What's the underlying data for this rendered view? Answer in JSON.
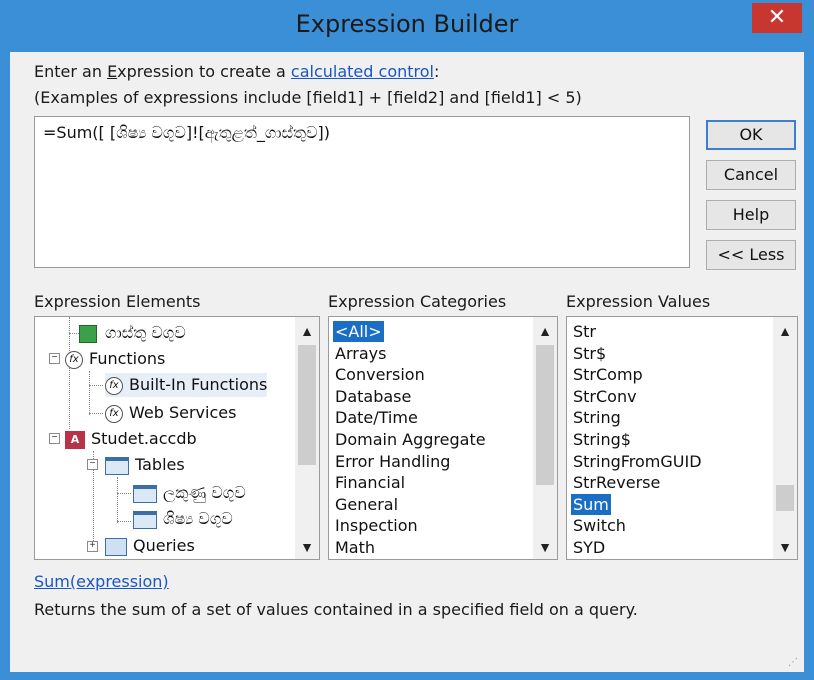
{
  "window": {
    "title": "Expression Builder",
    "close_glyph": "✕"
  },
  "header": {
    "line1_prefix": "Enter an ",
    "line1_underlined": "E",
    "line1_mid": "xpression to create a ",
    "line1_link": "calculated control",
    "line1_suffix": ":",
    "line2": "(Examples of expressions include [field1] + [field2] and [field1] < 5)"
  },
  "expression": {
    "value": "=Sum([ [ශිෂ්‍ය වගුව]![ඇතුළත්_ගාස්තුව])"
  },
  "buttons": {
    "ok": "OK",
    "cancel": "Cancel",
    "help": "Help",
    "less": "<< Less"
  },
  "elements": {
    "label": "Expression Elements",
    "tree": {
      "fee_table": "ගාස්තු වගුව",
      "functions": "Functions",
      "builtin": "Built-In Functions",
      "web_services": "Web Services",
      "db": "Studet.accdb",
      "db_icon": "A",
      "tables": "Tables",
      "table1": "ලකුණු වගුව",
      "table2": "ශිෂ්‍ය වගුව",
      "queries": "Queries"
    }
  },
  "categories": {
    "label": "Expression Categories",
    "items": [
      "<All>",
      "Arrays",
      "Conversion",
      "Database",
      "Date/Time",
      "Domain Aggregate",
      "Error Handling",
      "Financial",
      "General",
      "Inspection",
      "Math"
    ],
    "selected": "<All>"
  },
  "values": {
    "label": "Expression Values",
    "items": [
      "Str",
      "Str$",
      "StrComp",
      "StrConv",
      "String",
      "String$",
      "StringFromGUID",
      "StrReverse",
      "Sum",
      "Switch",
      "SYD"
    ],
    "selected": "Sum"
  },
  "footer": {
    "signature": "Sum(expression)",
    "description": "Returns the sum of a set of values contained in a specified field on a query."
  },
  "icons": {
    "scroll_up": "▲",
    "scroll_down": "▼",
    "grip": "⋰"
  },
  "colors": {
    "titlebar": "#3b8fd6",
    "close": "#c7372f",
    "selection": "#1a6fc4",
    "link": "#1a56c4"
  }
}
